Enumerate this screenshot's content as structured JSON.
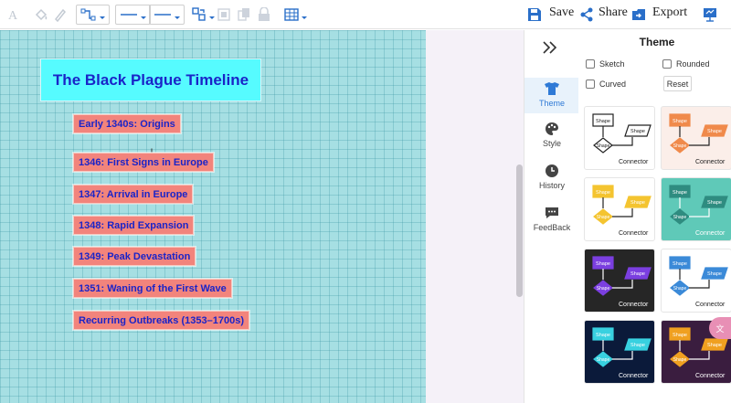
{
  "toolbar": {
    "save_label": "Save",
    "share_label": "Share",
    "export_label": "Export",
    "icons": [
      "text-icon",
      "fill-icon",
      "pen-icon",
      "connector-style-icon",
      "line-style-icon",
      "line-weight-icon",
      "arrange-icon",
      "group-icon",
      "copy-icon",
      "lock-icon",
      "table-icon",
      "save-icon",
      "share-icon",
      "export-icon",
      "present-icon"
    ]
  },
  "diagram": {
    "title": "The Black Plague Timeline",
    "nodes": [
      {
        "label": "Early 1340s: Origins"
      },
      {
        "label": "1346: First Signs in Europe"
      },
      {
        "label": "1347: Arrival in Europe"
      },
      {
        "label": "1348: Rapid Expansion"
      },
      {
        "label": "1349: Peak Devastation"
      },
      {
        "label": "1351: Waning of the First Wave"
      },
      {
        "label": "Recurring Outbreaks (1353–1700s)"
      }
    ],
    "colors": {
      "canvas": "#a6dfe3",
      "title_fill": "#56fbff",
      "node_fill": "#f2847c",
      "text": "#1a24c8"
    }
  },
  "side_tabs": [
    {
      "label": "Theme",
      "icon": "tshirt-icon",
      "active": true
    },
    {
      "label": "Style",
      "icon": "palette-icon",
      "active": false
    },
    {
      "label": "History",
      "icon": "clock-icon",
      "active": false
    },
    {
      "label": "FeedBack",
      "icon": "chat-icon",
      "active": false
    }
  ],
  "panel": {
    "title": "Theme",
    "options": [
      {
        "label": "Sketch",
        "checked": false
      },
      {
        "label": "Rounded",
        "checked": false
      },
      {
        "label": "Curved",
        "checked": false
      }
    ],
    "reset_label": "Reset",
    "themes": [
      {
        "shape_label": "Shape",
        "connector_label": "Connector",
        "bg": "#ffffff",
        "accent": "#222222",
        "text": "#222222"
      },
      {
        "shape_label": "Shape",
        "connector_label": "Connector",
        "bg": "#fbeee9",
        "accent": "#f08a4b",
        "text": "#222222"
      },
      {
        "shape_label": "Shape",
        "connector_label": "Connector",
        "bg": "#ffffff",
        "accent": "#f4c430",
        "text": "#222222"
      },
      {
        "shape_label": "Shape",
        "connector_label": "Connector",
        "bg": "#5fc9b8",
        "accent": "#2f8c80",
        "text": "#ffffff"
      },
      {
        "shape_label": "Shape",
        "connector_label": "Connector",
        "bg": "#262626",
        "accent": "#7b3fe0",
        "text": "#ffffff"
      },
      {
        "shape_label": "Shape",
        "connector_label": "Connector",
        "bg": "#ffffff",
        "accent": "#3b8ad8",
        "text": "#222222"
      },
      {
        "shape_label": "Shape",
        "connector_label": "Connector",
        "bg": "#0b1a3a",
        "accent": "#38d1e0",
        "text": "#ffffff"
      },
      {
        "shape_label": "Shape",
        "connector_label": "Connector",
        "bg": "#3a1d3f",
        "accent": "#f0a020",
        "text": "#ffffff"
      }
    ]
  }
}
